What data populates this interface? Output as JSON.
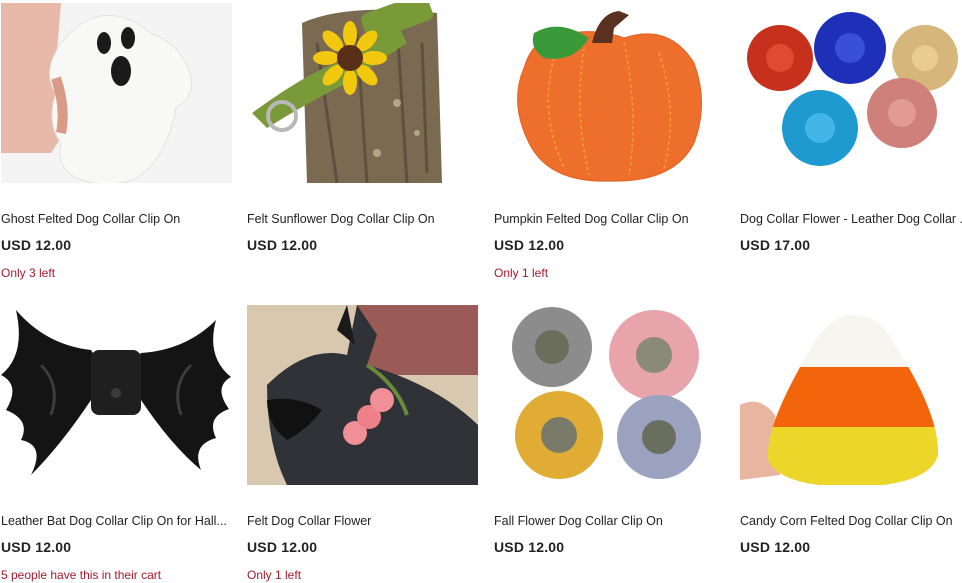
{
  "products": [
    {
      "title": "Ghost Felted Dog Collar Clip On",
      "price": "USD 12.00",
      "stock": "Only 3 left",
      "image_icon": "ghost-image"
    },
    {
      "title": "Felt Sunflower Dog Collar Clip On",
      "price": "USD 12.00",
      "stock": "",
      "image_icon": "sunflower-collar-image"
    },
    {
      "title": "Pumpkin Felted Dog Collar Clip On",
      "price": "USD 12.00",
      "stock": "Only 1 left",
      "image_icon": "pumpkin-image"
    },
    {
      "title": "Dog Collar Flower - Leather Dog Collar ...",
      "price": "USD 17.00",
      "stock": "",
      "image_icon": "leather-flowers-image"
    },
    {
      "title": "Leather Bat Dog Collar Clip On for Hall...",
      "price": "USD 12.00",
      "stock": "5 people have this in their cart",
      "image_icon": "bat-image"
    },
    {
      "title": "Felt Dog Collar Flower",
      "price": "USD 12.00",
      "stock": "Only 1 left",
      "image_icon": "dog-flower-image"
    },
    {
      "title": "Fall Flower Dog Collar Clip On",
      "price": "USD 12.00",
      "stock": "",
      "image_icon": "fall-flowers-image"
    },
    {
      "title": "Candy Corn Felted Dog Collar Clip On",
      "price": "USD 12.00",
      "stock": "",
      "image_icon": "candy-corn-image"
    }
  ],
  "colors": {
    "stock_text": "#a61a2e",
    "price_text": "#222222"
  }
}
